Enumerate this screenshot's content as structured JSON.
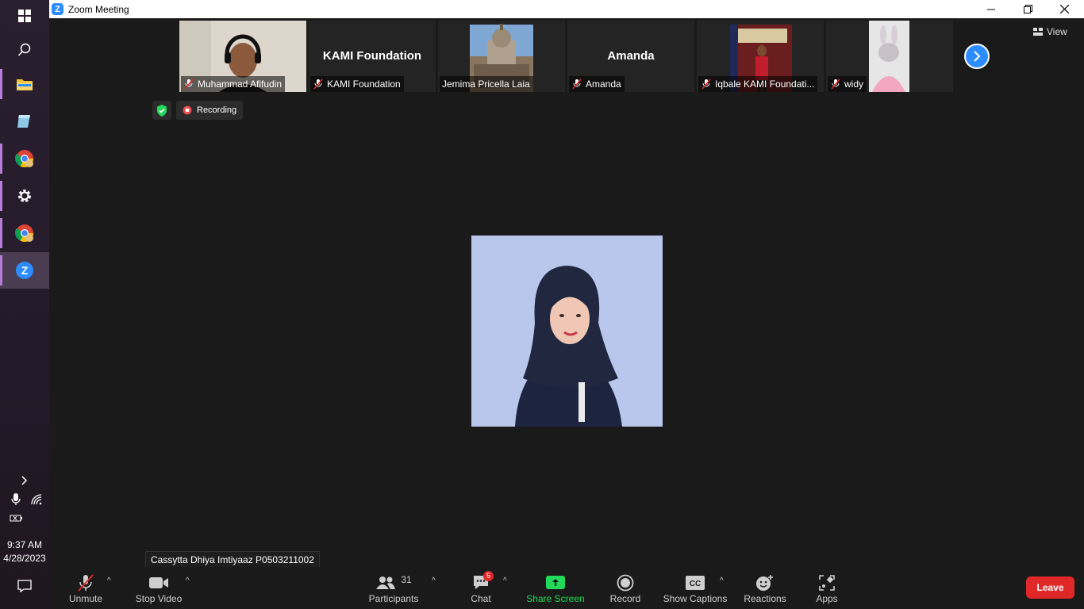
{
  "window": {
    "title": "Zoom Meeting"
  },
  "taskbar": {
    "clock_time": "9:37 AM",
    "clock_date": "4/28/2023"
  },
  "gallery": {
    "view_label": "View",
    "tiles": [
      {
        "name": "Muhammad Afifudin",
        "muted": true,
        "type": "video"
      },
      {
        "name": "KAMI Foundation",
        "big_name": "KAMI Foundation",
        "muted": true,
        "type": "name"
      },
      {
        "name": "Jemima Pricella Laia",
        "muted": false,
        "type": "video"
      },
      {
        "name": "Amanda",
        "big_name": "Amanda",
        "muted": true,
        "type": "name"
      },
      {
        "name": "Iqbale KAMI Foundati...",
        "muted": true,
        "type": "video"
      },
      {
        "name": "widy",
        "muted": true,
        "type": "video"
      }
    ]
  },
  "status": {
    "recording_label": "Recording"
  },
  "speaker": {
    "name_tag": "Cassytta Dhiya Imtiyaaz P0503211002"
  },
  "toolbar": {
    "unmute": "Unmute",
    "stop_video": "Stop Video",
    "participants": "Participants",
    "participants_count": "31",
    "chat": "Chat",
    "chat_badge": "5",
    "share_screen": "Share Screen",
    "record": "Record",
    "show_captions": "Show Captions",
    "reactions": "Reactions",
    "apps": "Apps",
    "leave": "Leave"
  },
  "colors": {
    "accent_blue": "#2d8cff",
    "share_green": "#23d959",
    "leave_red": "#e02828",
    "muted_red": "#e02828"
  }
}
